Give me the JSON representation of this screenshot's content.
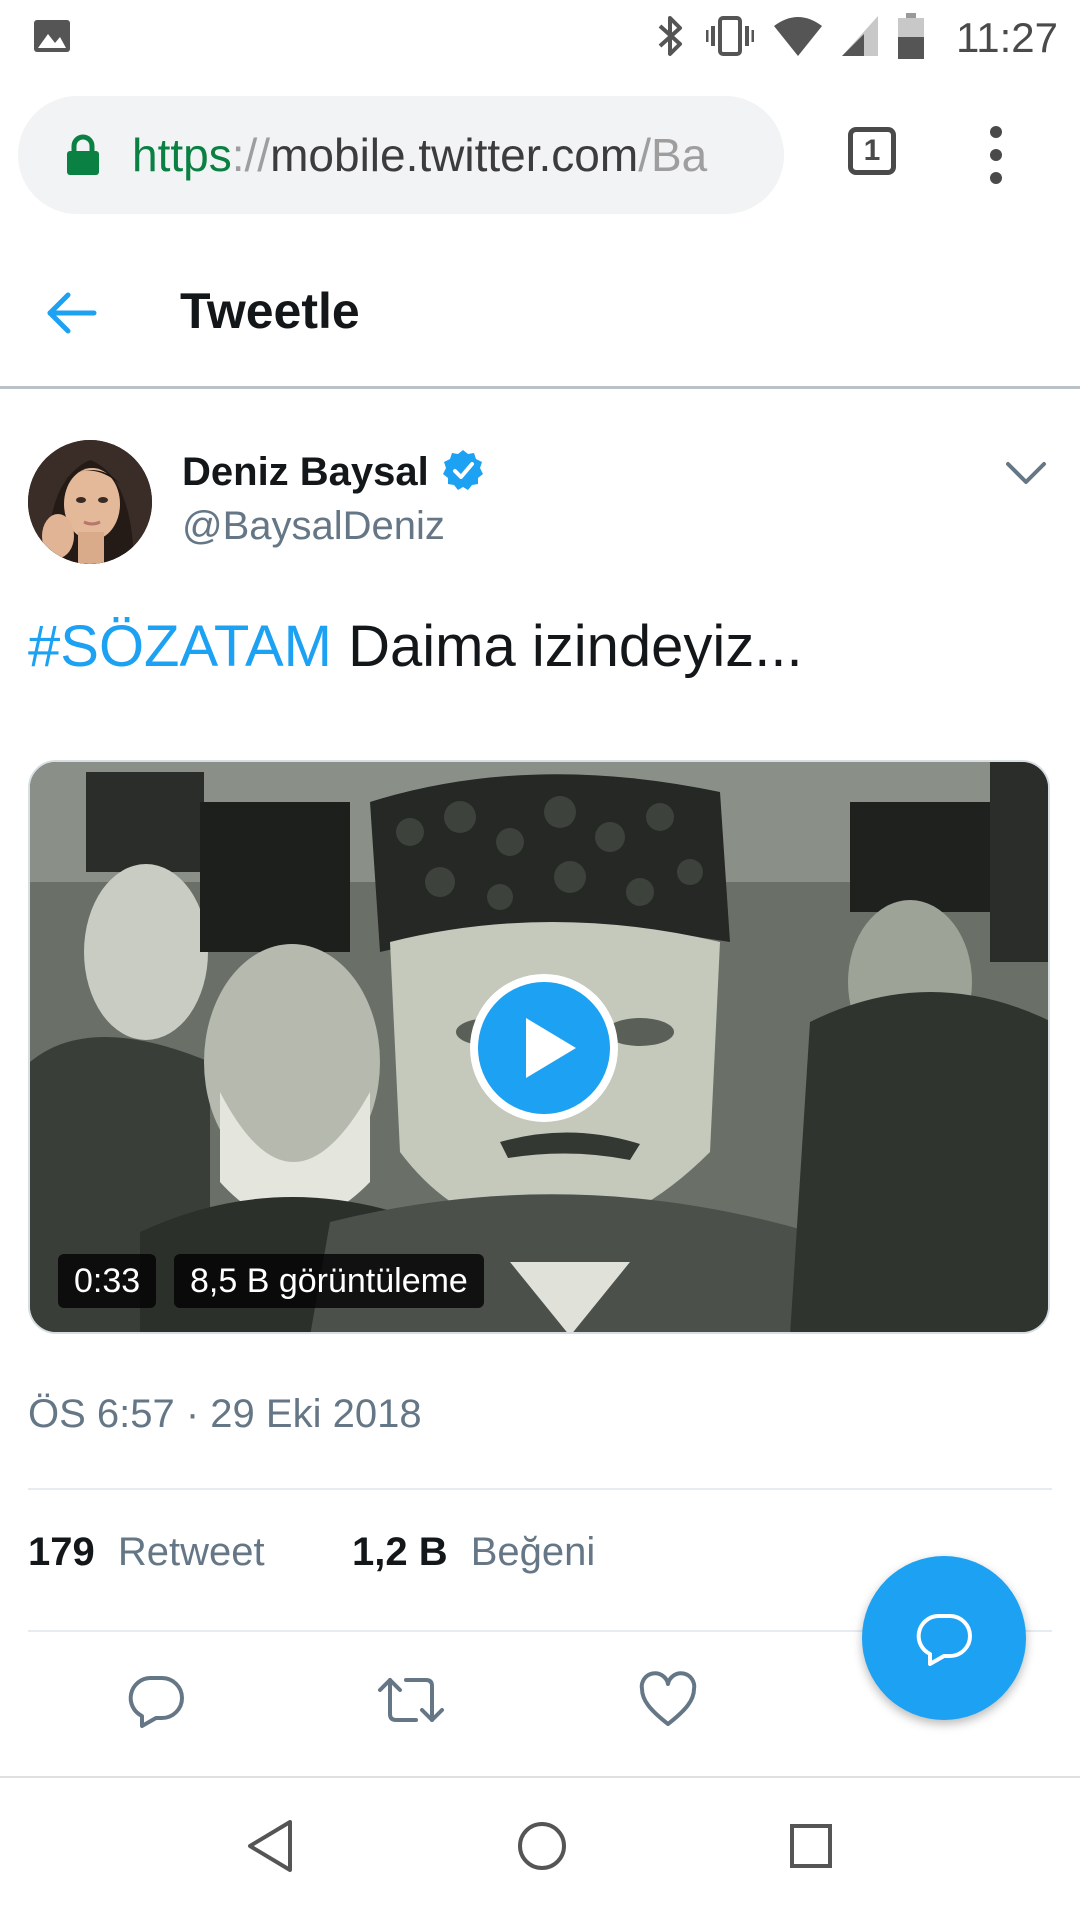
{
  "status_bar": {
    "time": "11:27",
    "icons": [
      "image-icon",
      "bluetooth-icon",
      "vibrate-icon",
      "wifi-icon",
      "cell-signal-icon",
      "battery-icon"
    ]
  },
  "browser": {
    "url_scheme": "https",
    "url_separator": "://",
    "url_host": "mobile.twitter.com",
    "url_path": "/Ba",
    "tab_count": "1",
    "secure_color": "#0b8043"
  },
  "header": {
    "title": "Tweetle"
  },
  "tweet": {
    "display_name": "Deniz Baysal",
    "handle": "@BaysalDeniz",
    "verified": true,
    "hashtag": "#SÖZATAM",
    "text": " Daima izindeyiz...",
    "media": {
      "type": "video",
      "duration": "0:33",
      "views": "8,5 B görüntüleme"
    },
    "timestamp": "ÖS 6:57 · 29 Eki 2018",
    "stats": {
      "retweets_count": "179",
      "retweets_label": "Retweet",
      "likes_count": "1,2 B",
      "likes_label": "Beğeni"
    }
  },
  "colors": {
    "accent": "#1da1f2",
    "text_primary": "#14171a",
    "text_secondary": "#657786"
  }
}
